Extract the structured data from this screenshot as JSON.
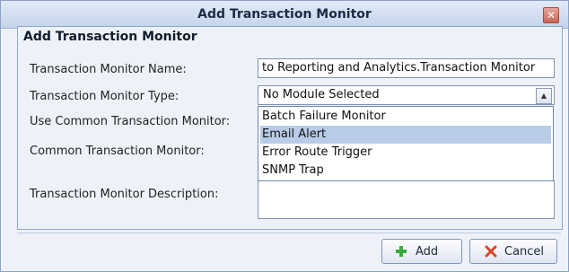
{
  "window": {
    "title": "Add Transaction Monitor",
    "close_icon": "close-icon"
  },
  "panel": {
    "title": "Add Transaction Monitor"
  },
  "form": {
    "name_label": "Transaction Monitor Name:",
    "name_value": "to Reporting and Analytics.Transaction Monitor",
    "type_label": "Transaction Monitor Type:",
    "type_value": "No Module Selected",
    "use_common_label": "Use Common Transaction Monitor:",
    "common_label": "Common Transaction Monitor:",
    "description_label": "Transaction Monitor Description:"
  },
  "dropdown": {
    "options": [
      "Batch Failure Monitor",
      "Email Alert",
      "Error Route Trigger",
      "SNMP Trap"
    ],
    "highlighted_index": 1
  },
  "buttons": {
    "add_label": "Add",
    "cancel_label": "Cancel"
  },
  "colors": {
    "add_icon": "#3bab3b",
    "cancel_icon": "#d24a2b"
  }
}
